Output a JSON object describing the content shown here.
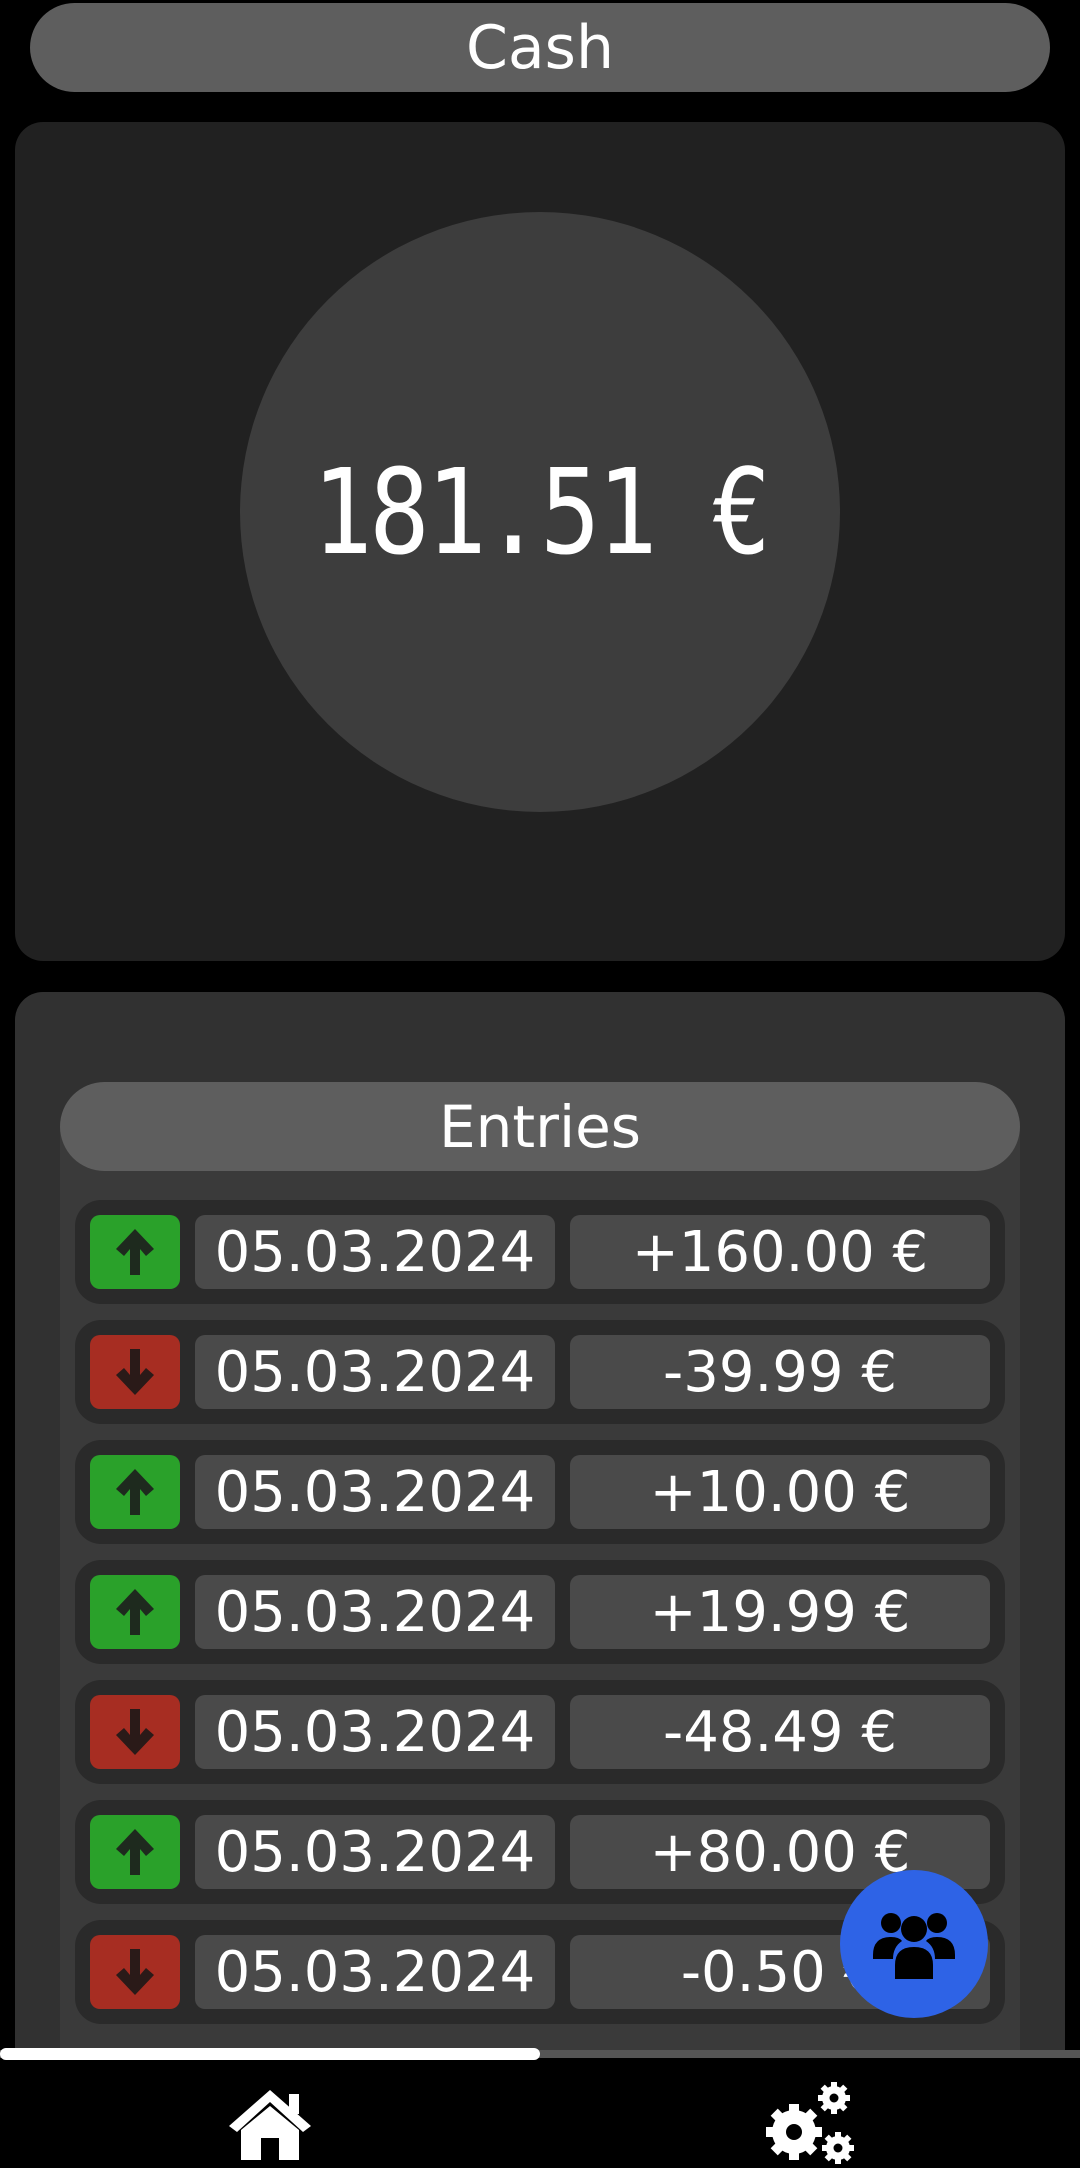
{
  "header": {
    "title": "Cash"
  },
  "balance": {
    "amount_text": "181.51 €"
  },
  "entries": {
    "title": "Entries",
    "rows": [
      {
        "direction": "up",
        "date": "05.03.2024",
        "amount": "+160.00 €"
      },
      {
        "direction": "down",
        "date": "05.03.2024",
        "amount": "-39.99 €"
      },
      {
        "direction": "up",
        "date": "05.03.2024",
        "amount": "+10.00 €"
      },
      {
        "direction": "up",
        "date": "05.03.2024",
        "amount": "+19.99 €"
      },
      {
        "direction": "down",
        "date": "05.03.2024",
        "amount": "-48.49 €"
      },
      {
        "direction": "up",
        "date": "05.03.2024",
        "amount": "+80.00 €"
      },
      {
        "direction": "down",
        "date": "05.03.2024",
        "amount": "-0.50 €"
      }
    ]
  },
  "fab": {
    "icon": "group-icon"
  },
  "bottom_nav": {
    "items": [
      {
        "icon": "home-icon",
        "active": true
      },
      {
        "icon": "settings-icon",
        "active": false
      }
    ]
  },
  "colors": {
    "income": "#2aa12a",
    "expense": "#a72d22",
    "accent": "#2e63e6"
  }
}
